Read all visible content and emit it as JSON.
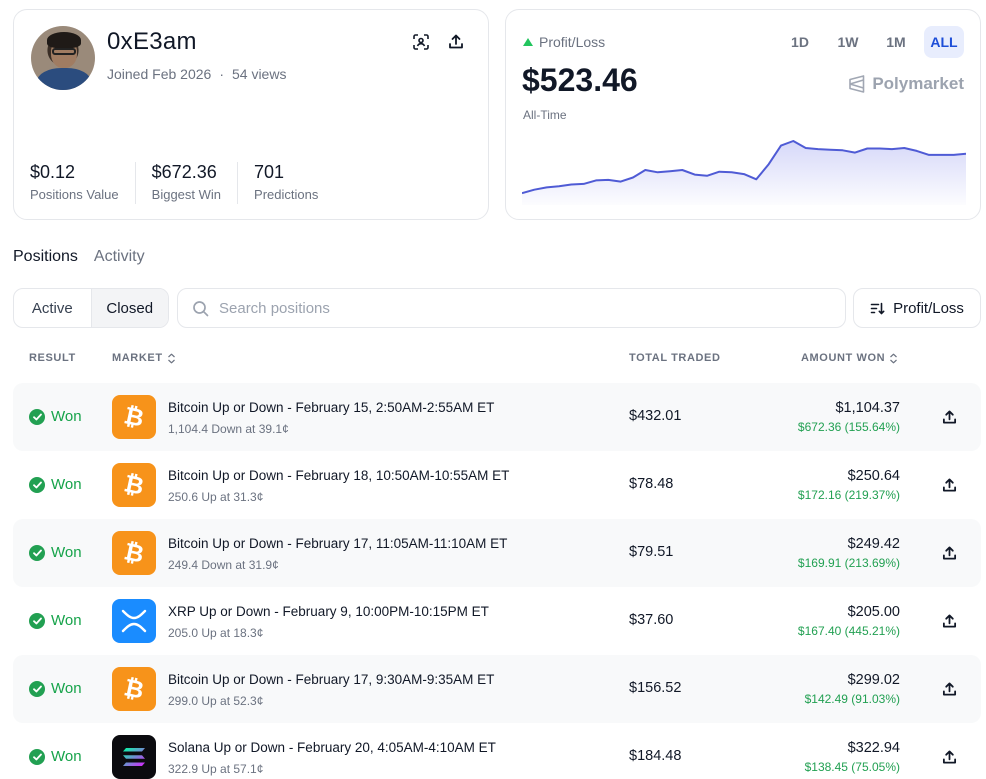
{
  "profile": {
    "username": "0xE3am",
    "joined": "Joined Feb 2026",
    "separator": "·",
    "views": "54 views",
    "stats": [
      {
        "value": "$0.12",
        "label": "Positions Value"
      },
      {
        "value": "$672.36",
        "label": "Biggest Win"
      },
      {
        "value": "701",
        "label": "Predictions"
      }
    ]
  },
  "pnl": {
    "label": "Profit/Loss",
    "value": "$523.46",
    "period_label": "All-Time",
    "brand": "Polymarket",
    "ranges": [
      "1D",
      "1W",
      "1M",
      "ALL"
    ],
    "active_range": "ALL",
    "line_color": "#4f5bd5",
    "series_shape": [
      0.1,
      0.16,
      0.2,
      0.22,
      0.25,
      0.26,
      0.32,
      0.33,
      0.3,
      0.37,
      0.5,
      0.46,
      0.48,
      0.5,
      0.42,
      0.4,
      0.47,
      0.46,
      0.43,
      0.34,
      0.6,
      0.92,
      1.0,
      0.88,
      0.86,
      0.85,
      0.84,
      0.8,
      0.87,
      0.87,
      0.86,
      0.88,
      0.83,
      0.76,
      0.76,
      0.76,
      0.78
    ]
  },
  "tabs": {
    "positions": "Positions",
    "activity": "Activity",
    "active": "Positions"
  },
  "filter": {
    "active_label": "Active",
    "closed_label": "Closed",
    "selected": "Closed"
  },
  "search": {
    "placeholder": "Search positions",
    "value": ""
  },
  "sort": {
    "label": "Profit/Loss"
  },
  "table": {
    "headers": {
      "result": "RESULT",
      "market": "MARKET",
      "total_traded": "TOTAL TRADED",
      "amount_won": "AMOUNT WON"
    },
    "rows": [
      {
        "result": "Won",
        "icon": "bitcoin-icon",
        "title": "Bitcoin Up or Down - February 15, 2:50AM-2:55AM ET",
        "sub": "1,104.4 Down at 39.1¢",
        "traded": "$432.01",
        "amount": "$1,104.37",
        "profit": "$672.36 (155.64%)"
      },
      {
        "result": "Won",
        "icon": "bitcoin-icon",
        "title": "Bitcoin Up or Down - February 18, 10:50AM-10:55AM ET",
        "sub": "250.6 Up at 31.3¢",
        "traded": "$78.48",
        "amount": "$250.64",
        "profit": "$172.16 (219.37%)"
      },
      {
        "result": "Won",
        "icon": "bitcoin-icon",
        "title": "Bitcoin Up or Down - February 17, 11:05AM-11:10AM ET",
        "sub": "249.4 Down at 31.9¢",
        "traded": "$79.51",
        "amount": "$249.42",
        "profit": "$169.91 (213.69%)"
      },
      {
        "result": "Won",
        "icon": "xrp-icon",
        "title": "XRP Up or Down - February 9, 10:00PM-10:15PM ET",
        "sub": "205.0 Up at 18.3¢",
        "traded": "$37.60",
        "amount": "$205.00",
        "profit": "$167.40 (445.21%)"
      },
      {
        "result": "Won",
        "icon": "bitcoin-icon",
        "title": "Bitcoin Up or Down - February 17, 9:30AM-9:35AM ET",
        "sub": "299.0 Up at 52.3¢",
        "traded": "$156.52",
        "amount": "$299.02",
        "profit": "$142.49 (91.03%)"
      },
      {
        "result": "Won",
        "icon": "solana-icon",
        "title": "Solana Up or Down - February 20, 4:05AM-4:10AM ET",
        "sub": "322.9 Up at 57.1¢",
        "traded": "$184.48",
        "amount": "$322.94",
        "profit": "$138.45 (75.05%)"
      }
    ]
  },
  "colors": {
    "bitcoin": "#f7931a",
    "xrp": "#1a8cff",
    "solana": "#0b0b0f",
    "won": "#16a34a",
    "accent": "#1d4ed8"
  }
}
